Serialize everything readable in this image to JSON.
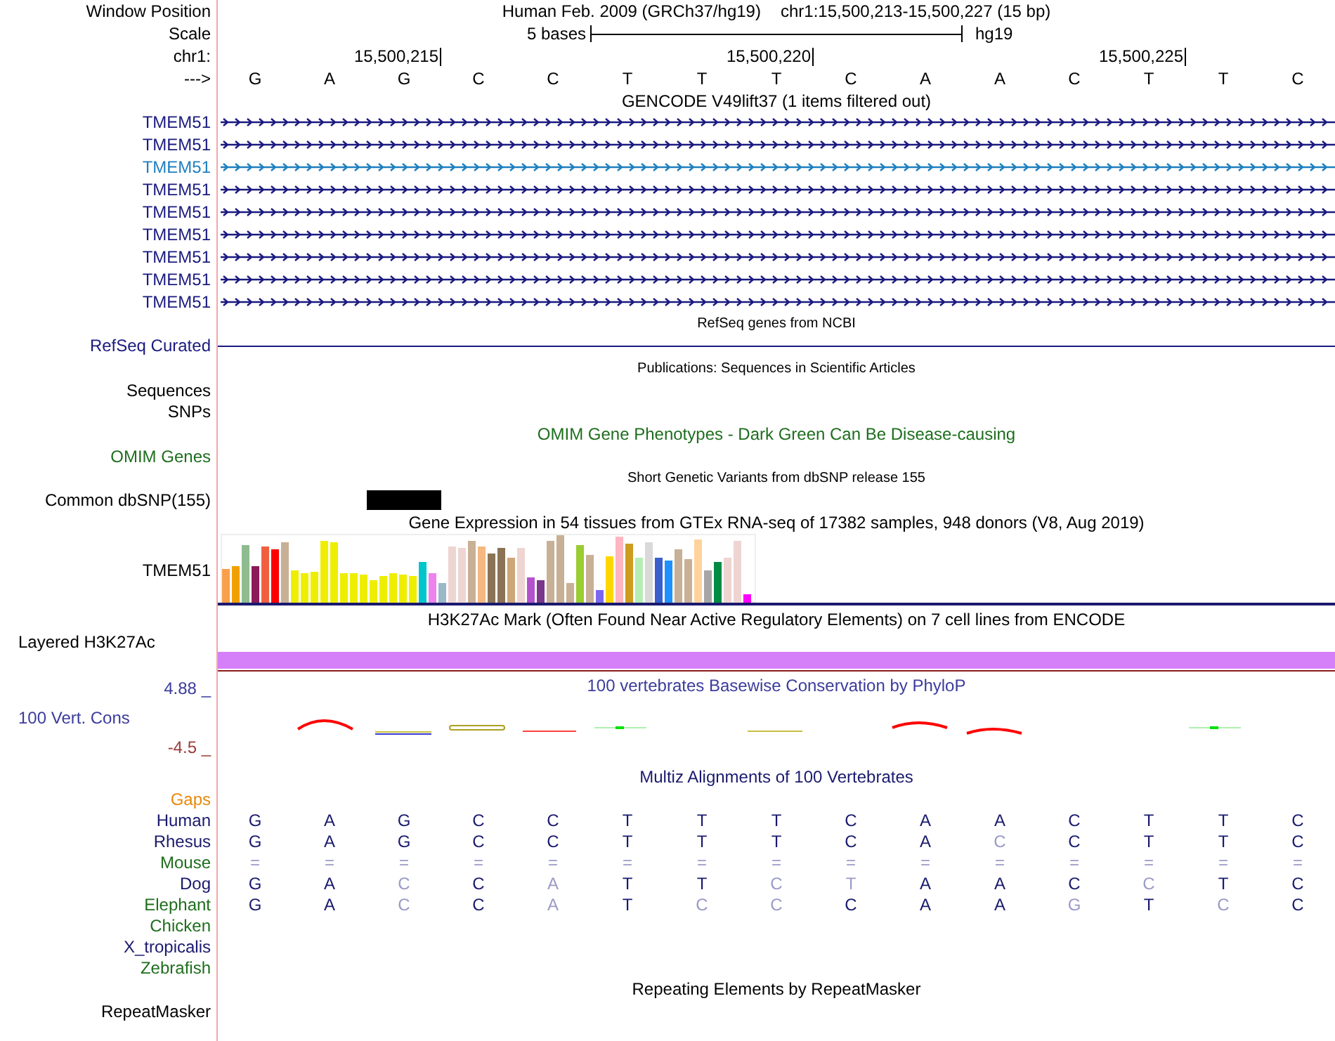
{
  "header": {
    "position_label": "Window Position",
    "title": "Human Feb. 2009 (GRCh37/hg19)",
    "position": "chr1:15,500,213-15,500,227 (15 bp)",
    "scale_label": "Scale",
    "scale_text": "5 bases",
    "assembly": "hg19",
    "chrom_label": "chr1:",
    "ticks": [
      "15,500,215",
      "15,500,220",
      "15,500,225"
    ],
    "strand_label": "--->",
    "bases": [
      "G",
      "A",
      "G",
      "C",
      "C",
      "T",
      "T",
      "T",
      "C",
      "A",
      "A",
      "C",
      "T",
      "T",
      "C"
    ]
  },
  "tracks": [
    {
      "kind": "genes",
      "title": "GENCODE V49lift37 (1 items filtered out)",
      "color": "#000000",
      "small": false,
      "items": [
        {
          "name": "TMEM51",
          "color": "#1a1a80"
        },
        {
          "name": "TMEM51",
          "color": "#1a1a80"
        },
        {
          "name": "TMEM51",
          "color": "#1f7fbf"
        },
        {
          "name": "TMEM51",
          "color": "#1a1a80"
        },
        {
          "name": "TMEM51",
          "color": "#1a1a80"
        },
        {
          "name": "TMEM51",
          "color": "#1a1a80"
        },
        {
          "name": "TMEM51",
          "color": "#1a1a80"
        },
        {
          "name": "TMEM51",
          "color": "#1a1a80"
        },
        {
          "name": "TMEM51",
          "color": "#1a1a80"
        }
      ]
    },
    {
      "kind": "line",
      "title": "RefSeq genes from NCBI",
      "color": "#000000",
      "small": true,
      "labels": [
        {
          "text": "RefSeq Curated",
          "color": "#1a1a80"
        }
      ]
    },
    {
      "kind": "empty",
      "title": "Publications: Sequences in Scientific Articles",
      "color": "#000000",
      "small": true,
      "labels": [
        {
          "text": "Sequences",
          "color": "#000000"
        },
        {
          "text": "SNPs",
          "color": "#000000"
        }
      ]
    },
    {
      "kind": "empty",
      "title": "OMIM Gene Phenotypes - Dark Green Can Be Disease-causing",
      "color": "#1e6e1e",
      "small": false,
      "labels": [
        {
          "text": "OMIM Genes",
          "color": "#1e6e1e"
        }
      ]
    },
    {
      "kind": "snp",
      "title": "Short Genetic Variants from dbSNP release 155",
      "color": "#000000",
      "small": true,
      "labels": [
        {
          "text": "Common dbSNP(155)",
          "color": "#000000"
        }
      ]
    },
    {
      "kind": "expression",
      "title": "Gene Expression in 54 tissues from GTEx RNA-seq of 17382 samples, 948 donors (V8, Aug 2019)",
      "color": "#000000",
      "small": false,
      "labels": [
        {
          "text": "TMEM51",
          "color": "#000000"
        }
      ]
    },
    {
      "kind": "layered",
      "title": "H3K27Ac Mark (Often Found Near Active Regulatory Elements) on 7 cell lines from ENCODE",
      "color": "#000000",
      "small": false,
      "labels": [
        {
          "text": "Layered H3K27Ac",
          "color": "#000000"
        }
      ]
    },
    {
      "kind": "wiggle",
      "title": "100 vertebrates Basewise Conservation by PhyloP",
      "color": "#3c3c9c",
      "small": false,
      "max": "4.88 _",
      "min": "-4.5 _",
      "labels": [
        {
          "text": "100 Vert. Cons",
          "color": "#3c3c9c"
        }
      ]
    },
    {
      "kind": "alignment",
      "title": "Multiz Alignments of 100 Vertebrates",
      "color": "#1a1a6e",
      "small": false,
      "rows": [
        {
          "name": "Gaps",
          "color": "#e8890c"
        },
        {
          "name": "Human",
          "color": "#1a1a6e",
          "bases": [
            {
              "b": "G",
              "dim": false
            },
            {
              "b": "A",
              "dim": false
            },
            {
              "b": "G",
              "dim": false
            },
            {
              "b": "C",
              "dim": false
            },
            {
              "b": "C",
              "dim": false
            },
            {
              "b": "T",
              "dim": false
            },
            {
              "b": "T",
              "dim": false
            },
            {
              "b": "T",
              "dim": false
            },
            {
              "b": "C",
              "dim": false
            },
            {
              "b": "A",
              "dim": false
            },
            {
              "b": "A",
              "dim": false
            },
            {
              "b": "C",
              "dim": false
            },
            {
              "b": "T",
              "dim": false
            },
            {
              "b": "T",
              "dim": false
            },
            {
              "b": "C",
              "dim": false
            }
          ]
        },
        {
          "name": "Rhesus",
          "color": "#1a1a6e",
          "bases": [
            {
              "b": "G",
              "dim": false
            },
            {
              "b": "A",
              "dim": false
            },
            {
              "b": "G",
              "dim": false
            },
            {
              "b": "C",
              "dim": false
            },
            {
              "b": "C",
              "dim": false
            },
            {
              "b": "T",
              "dim": false
            },
            {
              "b": "T",
              "dim": false
            },
            {
              "b": "T",
              "dim": false
            },
            {
              "b": "C",
              "dim": false
            },
            {
              "b": "A",
              "dim": false
            },
            {
              "b": "C",
              "dim": true
            },
            {
              "b": "C",
              "dim": false
            },
            {
              "b": "T",
              "dim": false
            },
            {
              "b": "T",
              "dim": false
            },
            {
              "b": "C",
              "dim": false
            }
          ]
        },
        {
          "name": "Mouse",
          "color": "#1e6e1e",
          "bases": [
            {
              "b": "=",
              "dim": true
            },
            {
              "b": "=",
              "dim": true
            },
            {
              "b": "=",
              "dim": true
            },
            {
              "b": "=",
              "dim": true
            },
            {
              "b": "=",
              "dim": true
            },
            {
              "b": "=",
              "dim": true
            },
            {
              "b": "=",
              "dim": true
            },
            {
              "b": "=",
              "dim": true
            },
            {
              "b": "=",
              "dim": true
            },
            {
              "b": "=",
              "dim": true
            },
            {
              "b": "=",
              "dim": true
            },
            {
              "b": "=",
              "dim": true
            },
            {
              "b": "=",
              "dim": true
            },
            {
              "b": "=",
              "dim": true
            },
            {
              "b": "=",
              "dim": true
            }
          ]
        },
        {
          "name": "Dog",
          "color": "#1a1a6e",
          "bases": [
            {
              "b": "G",
              "dim": false
            },
            {
              "b": "A",
              "dim": false
            },
            {
              "b": "C",
              "dim": true
            },
            {
              "b": "C",
              "dim": false
            },
            {
              "b": "A",
              "dim": true
            },
            {
              "b": "T",
              "dim": false
            },
            {
              "b": "T",
              "dim": false
            },
            {
              "b": "C",
              "dim": true
            },
            {
              "b": "T",
              "dim": true
            },
            {
              "b": "A",
              "dim": false
            },
            {
              "b": "A",
              "dim": false
            },
            {
              "b": "C",
              "dim": false
            },
            {
              "b": "C",
              "dim": true
            },
            {
              "b": "T",
              "dim": false
            },
            {
              "b": "C",
              "dim": false
            }
          ]
        },
        {
          "name": "Elephant",
          "color": "#1e6e1e",
          "bases": [
            {
              "b": "G",
              "dim": false
            },
            {
              "b": "A",
              "dim": false
            },
            {
              "b": "C",
              "dim": true
            },
            {
              "b": "C",
              "dim": false
            },
            {
              "b": "A",
              "dim": true
            },
            {
              "b": "T",
              "dim": false
            },
            {
              "b": "C",
              "dim": true
            },
            {
              "b": "C",
              "dim": true
            },
            {
              "b": "C",
              "dim": false
            },
            {
              "b": "A",
              "dim": false
            },
            {
              "b": "A",
              "dim": false
            },
            {
              "b": "G",
              "dim": true
            },
            {
              "b": "T",
              "dim": false
            },
            {
              "b": "C",
              "dim": true
            },
            {
              "b": "C",
              "dim": false
            }
          ]
        },
        {
          "name": "Chicken",
          "color": "#1e6e1e"
        },
        {
          "name": "X_tropicalis",
          "color": "#1a1a6e"
        },
        {
          "name": "Zebrafish",
          "color": "#1e6e1e"
        }
      ]
    },
    {
      "kind": "empty",
      "title": "Repeating Elements by RepeatMasker",
      "color": "#000000",
      "small": false,
      "labels": [
        {
          "text": "RepeatMasker",
          "color": "#000000"
        }
      ]
    }
  ]
}
